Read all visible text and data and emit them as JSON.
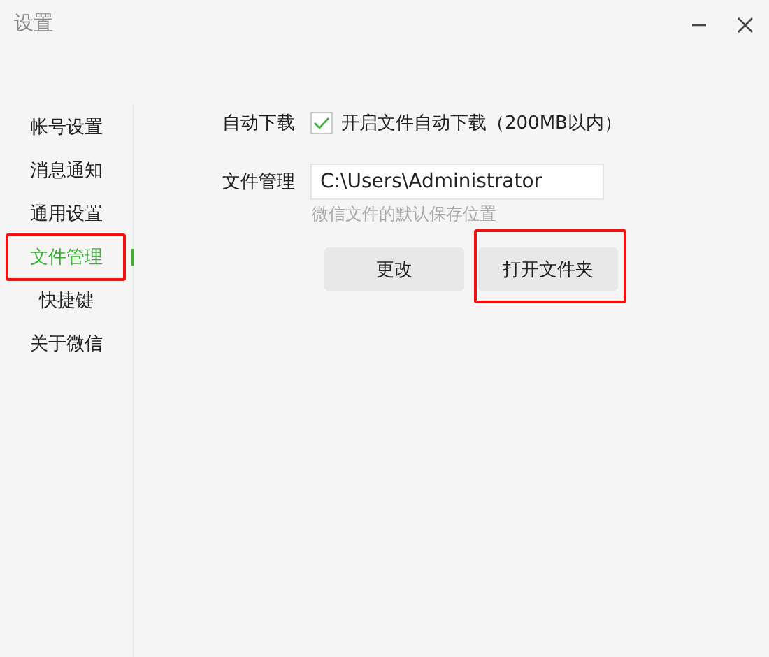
{
  "window": {
    "title": "设置",
    "controls": [
      {
        "kind": "minimize"
      },
      {
        "kind": "close"
      }
    ]
  },
  "sidebar": {
    "items": [
      {
        "label": "帐号设置",
        "selected": false,
        "highlighted": false
      },
      {
        "label": "消息通知",
        "selected": false,
        "highlighted": false
      },
      {
        "label": "通用设置",
        "selected": false,
        "highlighted": false
      },
      {
        "label": "文件管理",
        "selected": true,
        "highlighted": true
      },
      {
        "label": "快捷键",
        "selected": false,
        "highlighted": false
      },
      {
        "label": "关于微信",
        "selected": false,
        "highlighted": false
      }
    ]
  },
  "auto_download": {
    "label": "自动下载",
    "checkbox_label": "开启文件自动下载（200MB以内）",
    "checked": true
  },
  "file_management": {
    "label": "文件管理",
    "path": "C:\\Users\\Administrator",
    "hint": "微信文件的默认保存位置"
  },
  "buttons": [
    {
      "label": "更改",
      "highlighted": false
    },
    {
      "label": "打开文件夹",
      "highlighted": true
    }
  ]
}
